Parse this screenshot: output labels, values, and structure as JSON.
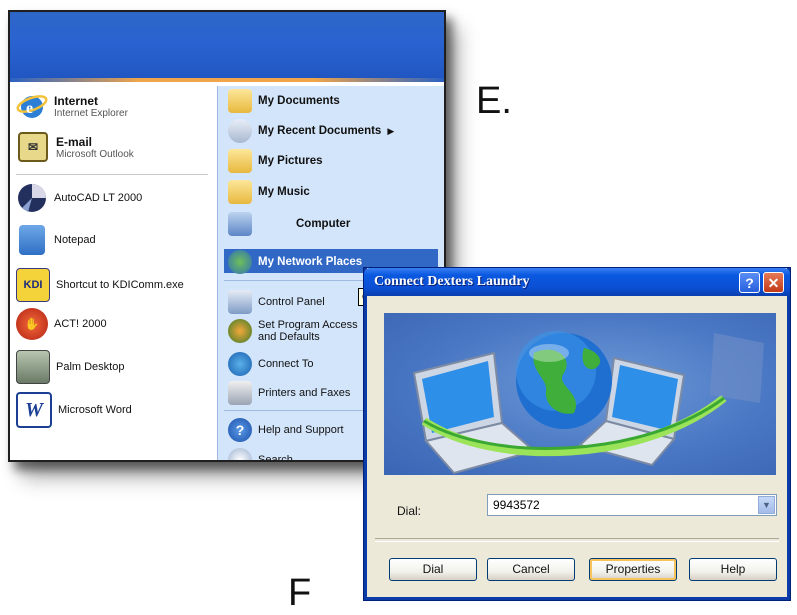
{
  "labels": {
    "e": "E.",
    "f": "F"
  },
  "start_menu": {
    "left_items": [
      {
        "title": "Internet",
        "subtitle": "Internet Explorer",
        "icon": "internet-explorer-icon"
      },
      {
        "title": "E-mail",
        "subtitle": "Microsoft Outlook",
        "icon": "outlook-icon"
      },
      {
        "label": "AutoCAD LT 2000",
        "icon": "autocad-icon"
      },
      {
        "label": "Notepad",
        "icon": "notepad-icon"
      },
      {
        "label": "Shortcut to KDIComm.exe",
        "icon": "kdi-icon"
      },
      {
        "label": "ACT! 2000",
        "icon": "act-icon"
      },
      {
        "label": "Palm Desktop",
        "icon": "palm-icon"
      },
      {
        "label": "Microsoft Word",
        "icon": "word-icon"
      }
    ],
    "right_items": [
      {
        "label": "My Documents",
        "icon": "folder-documents-icon"
      },
      {
        "label": "My Recent Documents",
        "icon": "recent-documents-icon"
      },
      {
        "label": "My Pictures",
        "icon": "folder-pictures-icon"
      },
      {
        "label": "My Music",
        "icon": "folder-music-icon"
      },
      {
        "label": "Computer",
        "icon": "computer-icon"
      },
      {
        "label": "My Network Places",
        "icon": "network-places-icon"
      },
      {
        "label": "Control Panel",
        "icon": "control-panel-icon"
      },
      {
        "label": "Set Program Access and Defaults",
        "icon": "program-access-icon"
      },
      {
        "label": "Connect To",
        "icon": "connect-to-icon"
      },
      {
        "label": "Printers and Faxes",
        "icon": "printer-icon"
      },
      {
        "label": "Help and Support",
        "icon": "help-icon"
      },
      {
        "label": "Search",
        "icon": "search-icon"
      }
    ],
    "tooltip": "G",
    "colors": {
      "header": "#2a63d1",
      "right_panel": "#d3e5fa",
      "selected": "#3168c6"
    }
  },
  "dialog": {
    "title": "Connect Dexters Laundry",
    "help_label": "?",
    "close_label": "✕",
    "dial_label": "Dial:",
    "dial_value": "9943572",
    "buttons": {
      "dial": "Dial",
      "cancel": "Cancel",
      "properties": "Properties",
      "help": "Help"
    },
    "colors": {
      "titlebar": "#0a59e0",
      "body": "#ece9d8"
    }
  }
}
